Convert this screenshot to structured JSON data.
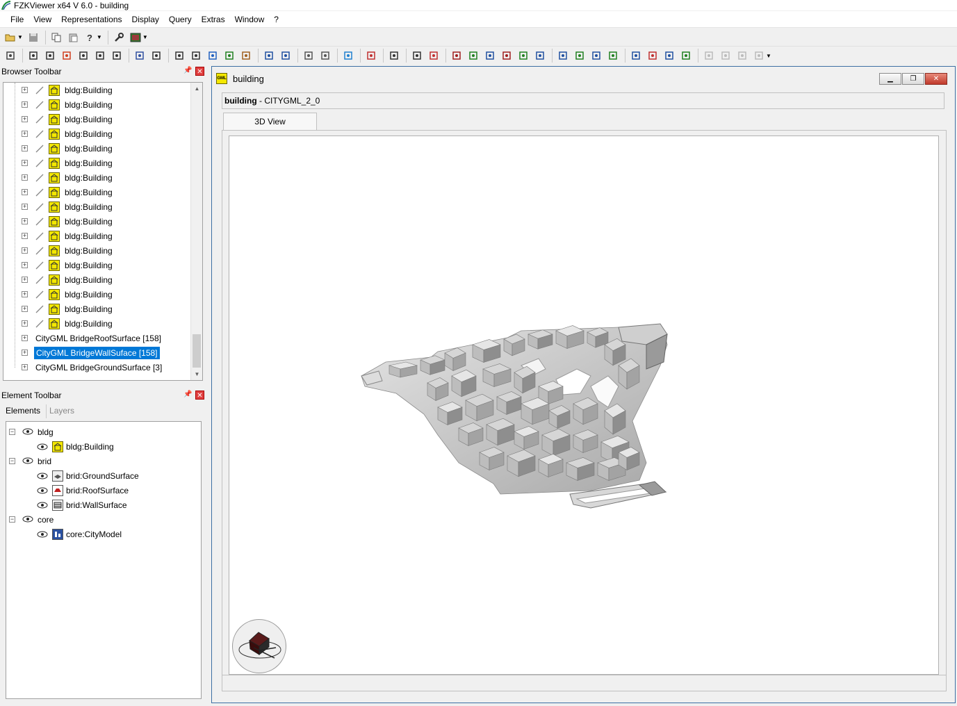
{
  "window": {
    "title": "FZKViewer x64 V 6.0 - building"
  },
  "menu": [
    "File",
    "View",
    "Representations",
    "Display",
    "Query",
    "Extras",
    "Window",
    "?"
  ],
  "browser_panel": {
    "title": "Browser Toolbar",
    "building_label": "bldg:Building",
    "building_count_visible": 17,
    "collections": [
      {
        "label": "CityGML BridgeRoofSurface [158]",
        "selected": false
      },
      {
        "label": "CityGML BridgeWallSuface [158]",
        "selected": true
      },
      {
        "label": "CityGML BridgeGroundSurface [3]",
        "selected": false
      }
    ]
  },
  "element_panel": {
    "title": "Element Toolbar",
    "tabs": [
      "Elements",
      "Layers"
    ],
    "groups": [
      {
        "name": "bldg",
        "children": [
          {
            "label": "bldg:Building",
            "icon": "building-icon"
          }
        ]
      },
      {
        "name": "brid",
        "children": [
          {
            "label": "brid:GroundSurface",
            "icon": "ground-surface-icon"
          },
          {
            "label": "brid:RoofSurface",
            "icon": "roof-surface-icon"
          },
          {
            "label": "brid:WallSurface",
            "icon": "wall-surface-icon"
          }
        ]
      },
      {
        "name": "core",
        "children": [
          {
            "label": "core:CityModel",
            "icon": "city-model-icon"
          }
        ]
      }
    ]
  },
  "document": {
    "window_title": "building",
    "header_bold": "building",
    "header_rest": " - CITYGML_2_0",
    "tab": "3D View",
    "icon_text": "GML"
  },
  "colors": {
    "selection": "#0078d7",
    "building_icon": "#f4e800"
  }
}
